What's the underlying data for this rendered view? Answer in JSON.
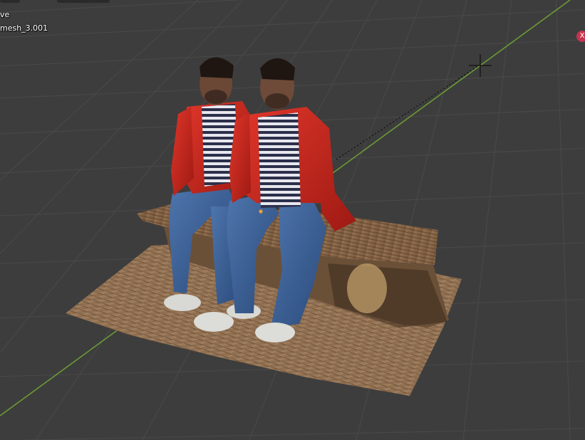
{
  "viewport": {
    "view_name": "ve",
    "active_object": "mesh_3.001",
    "gizmo_axis_label": "X"
  },
  "colors": {
    "background": "#3d3d3d",
    "grid_line": "#484848",
    "x_axis": "#8a3a45",
    "y_axis": "#6a9a36",
    "origin_point": "#f0a030",
    "jacket": "#c9271e",
    "jeans": "#3a5f96",
    "wood": "#8a6a4a"
  },
  "icons": [
    "3d-cursor-icon",
    "x-axis-gizmo-icon"
  ]
}
